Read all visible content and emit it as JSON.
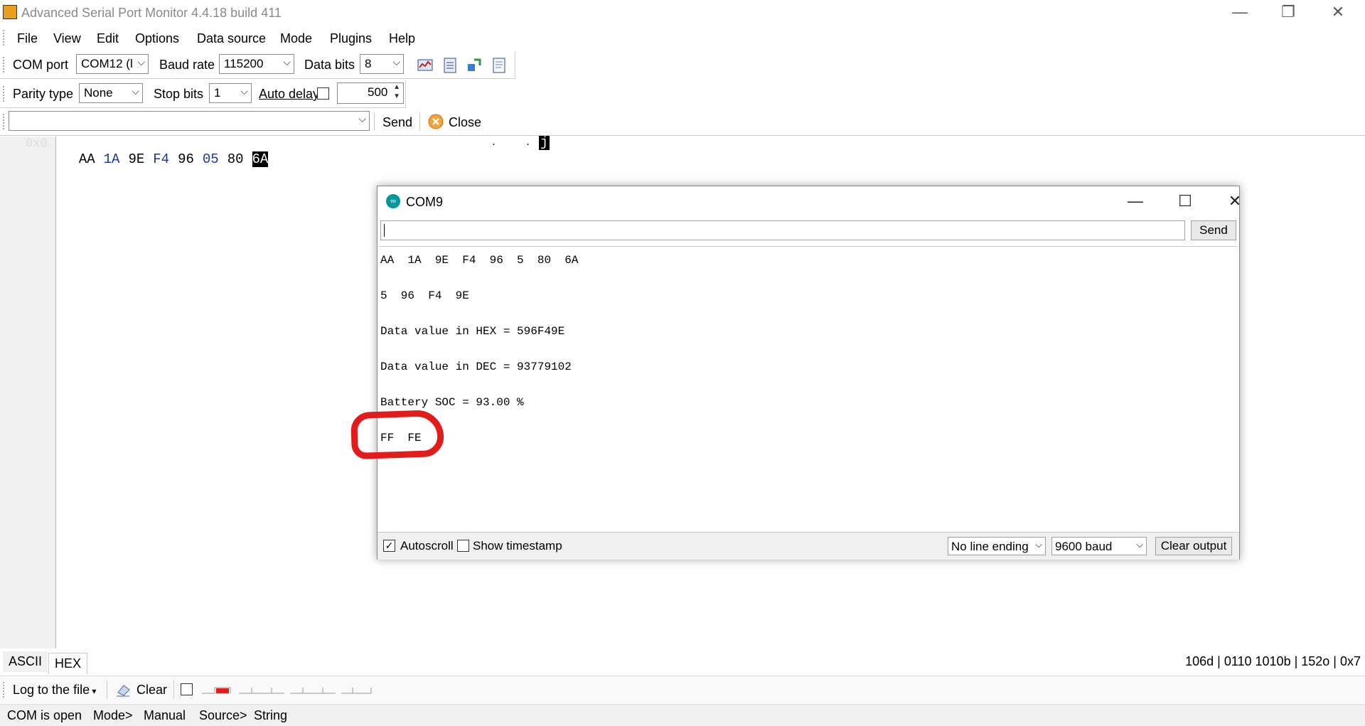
{
  "window": {
    "title": "Advanced Serial Port Monitor 4.4.18 build 411",
    "minimize_glyph": "—",
    "restore_glyph": "❐",
    "close_glyph": "✕"
  },
  "menu": [
    "File",
    "View",
    "Edit",
    "Options",
    "Data source",
    "Mode",
    "Plugins",
    "Help"
  ],
  "toolbar": {
    "com_port_label": "COM port",
    "com_port_value": "COM12 (l",
    "baud_label": "Baud rate",
    "baud_value": "115200",
    "data_bits_label": "Data bits",
    "data_bits_value": "8",
    "parity_label": "Parity type",
    "parity_value": "None",
    "stop_bits_label": "Stop bits",
    "stop_bits_value": "1",
    "auto_delay_label": "Auto delay",
    "auto_delay_checked": false,
    "delay_value": "500",
    "send_label": "Send",
    "close_label": "Close",
    "icons": [
      "port-settings-icon",
      "document-list-icon",
      "connect-plugin-icon",
      "notepad-icon"
    ]
  },
  "hexview": {
    "address": "0x0",
    "bytes": [
      {
        "v": "AA",
        "style": "normal"
      },
      {
        "v": "1A",
        "style": "blue"
      },
      {
        "v": "9E",
        "style": "normal"
      },
      {
        "v": "F4",
        "style": "blue"
      },
      {
        "v": "96",
        "style": "normal"
      },
      {
        "v": "05",
        "style": "blue"
      },
      {
        "v": "80",
        "style": "normal"
      },
      {
        "v": "6A",
        "style": "selected"
      }
    ],
    "ascii_end": "j"
  },
  "tabs": {
    "ascii": "ASCII",
    "hex": "HEX",
    "active": "HEX"
  },
  "bit_info": "106d | 0110 1010b | 152o | 0x7",
  "log_row": {
    "log_label": "Log to the file",
    "clear_label": "Clear"
  },
  "status": {
    "state": "COM is open",
    "mode_label": "Mode>",
    "mode_value": "Manual",
    "source_label": "Source>",
    "source_value": "String"
  },
  "com9": {
    "title": "COM9",
    "send_label": "Send",
    "lines": [
      "AA  1A  9E  F4  96  5  80  6A",
      "5  96  F4  9E",
      "Data value in HEX = 596F49E",
      "Data value in DEC = 93779102",
      "Battery SOC = 93.00 %",
      "FF  FE"
    ],
    "autoscroll_label": "Autoscroll",
    "autoscroll_checked": true,
    "timestamp_label": "Show timestamp",
    "timestamp_checked": false,
    "line_ending": "No line ending",
    "baud": "9600 baud",
    "clear_label": "Clear output"
  },
  "colors": {
    "annotation": "#e21b1b",
    "arduino_teal": "#00979c",
    "hex_blue": "#1a35a0"
  }
}
